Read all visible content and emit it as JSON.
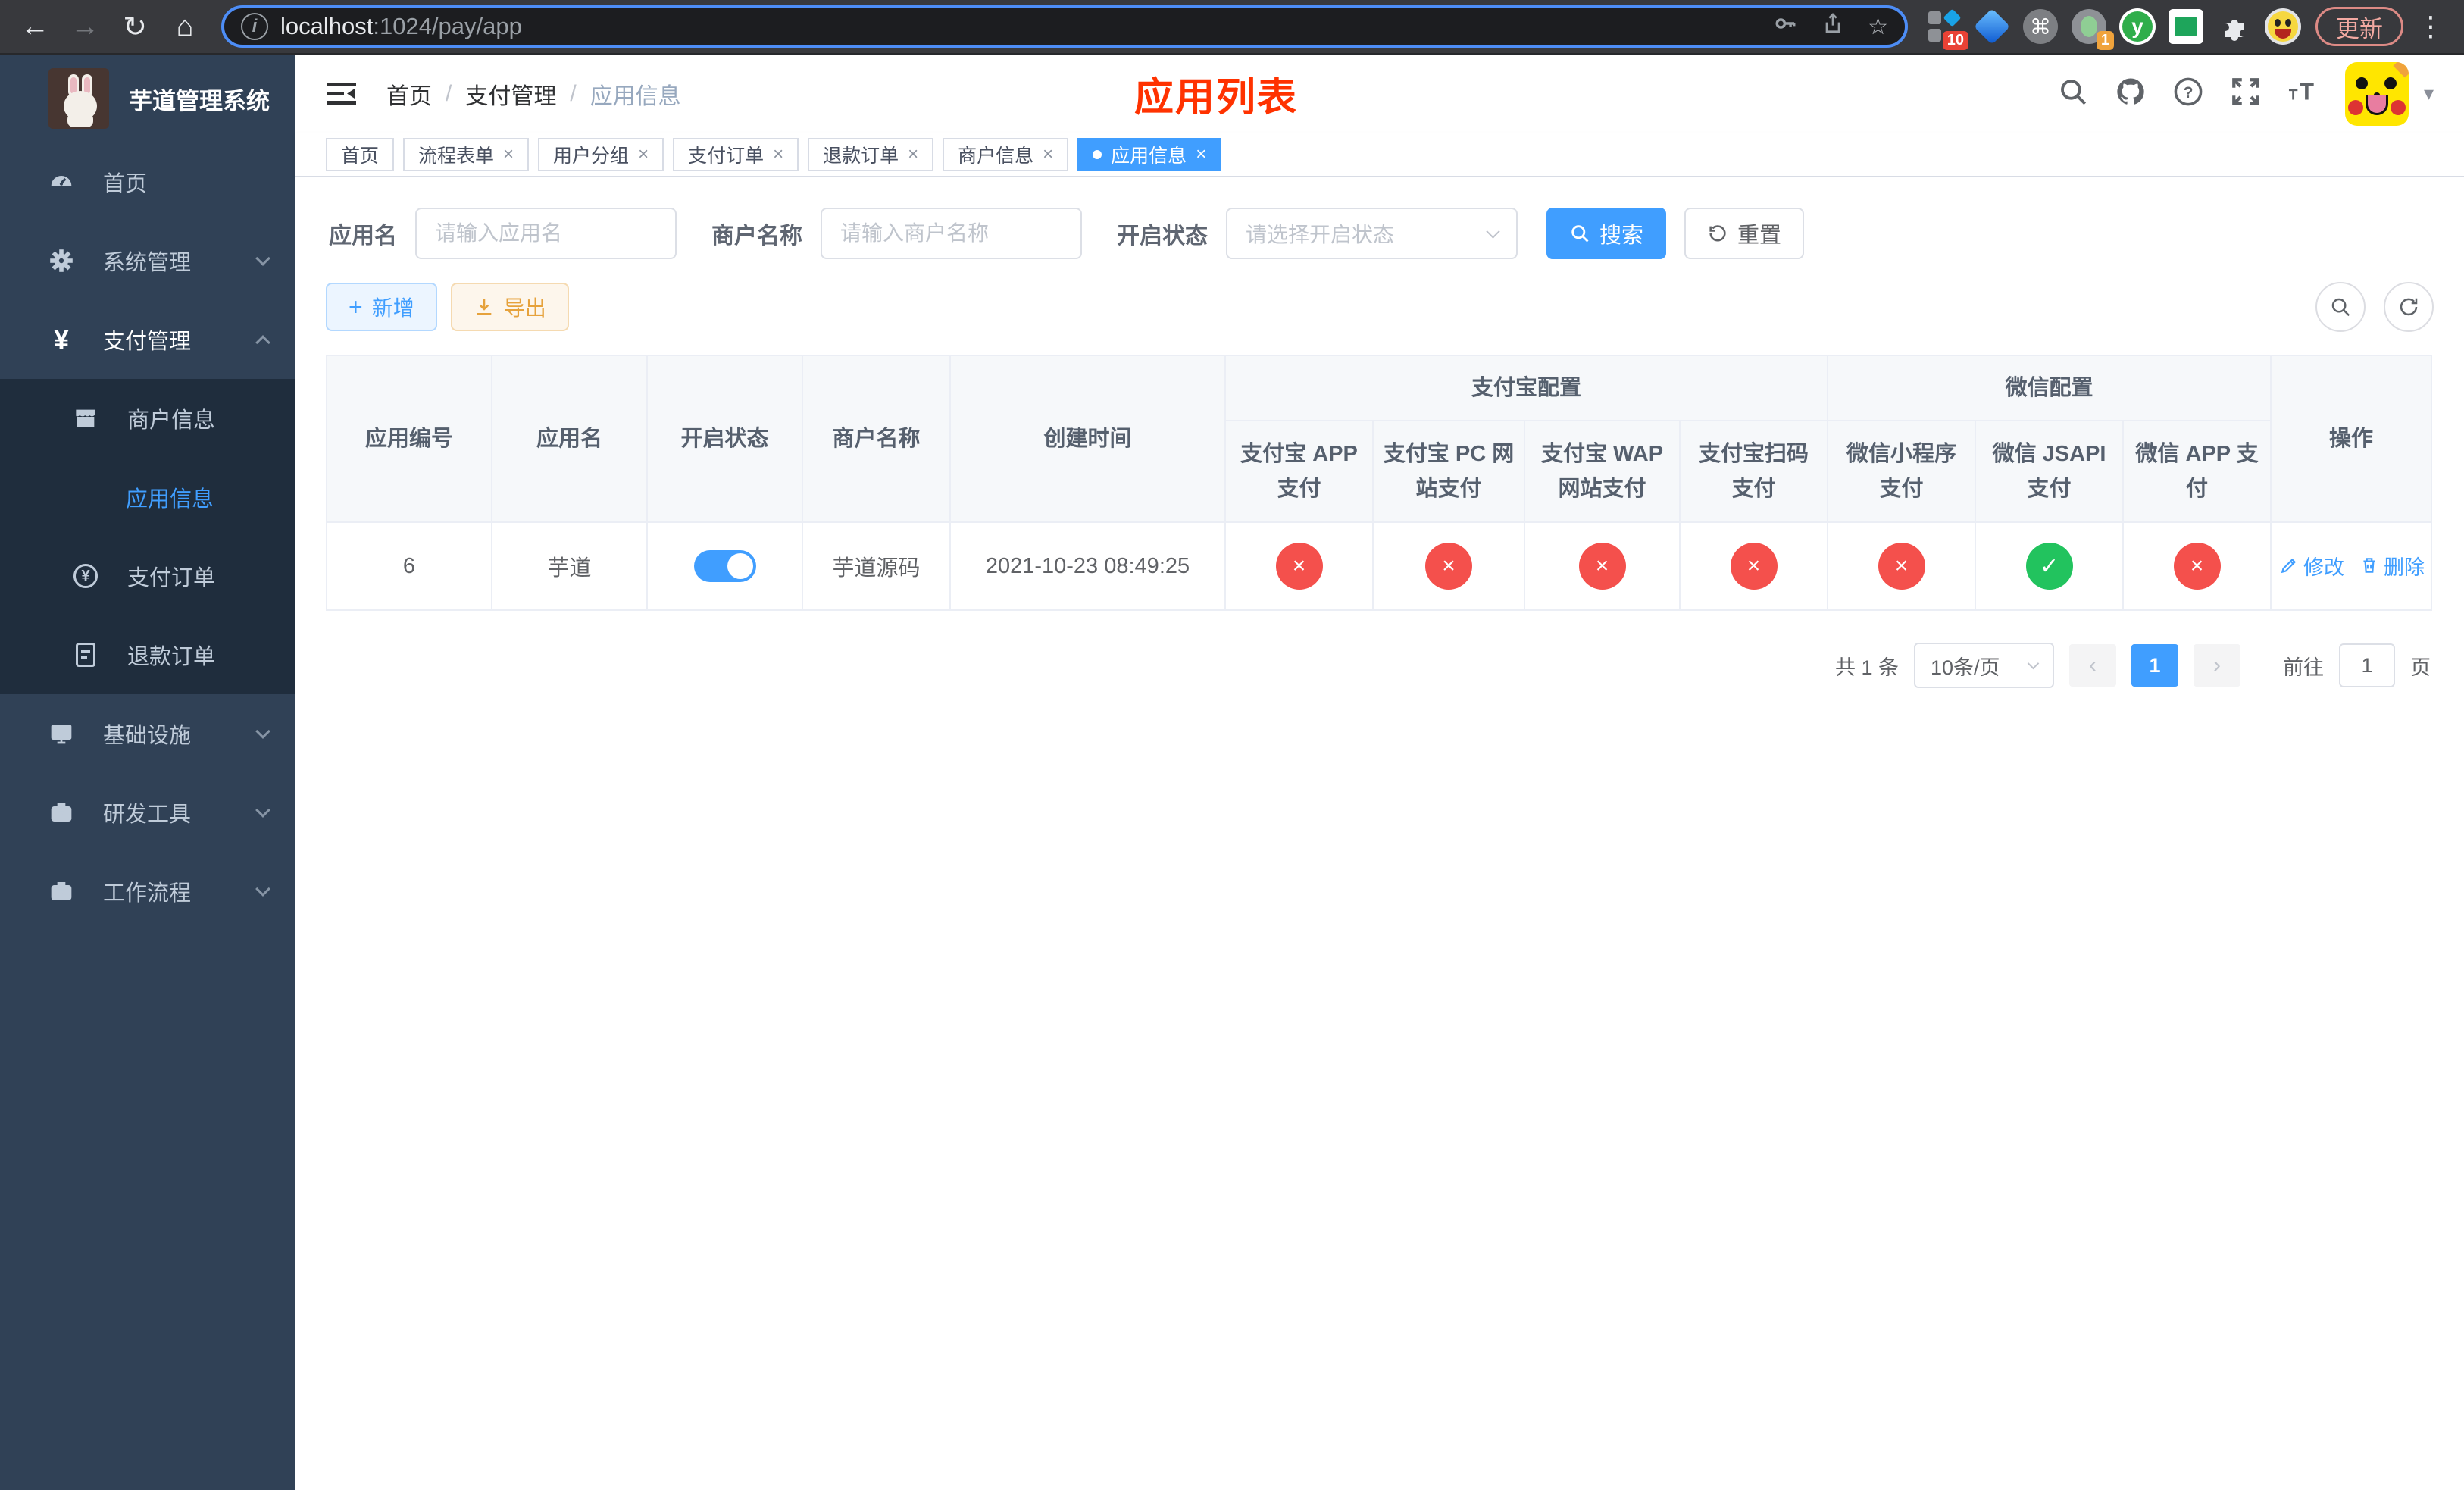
{
  "browser": {
    "host": "localhost",
    "path": ":1024/pay/app",
    "update_label": "更新",
    "ext_badge_grid": "10",
    "ext_badge_profile": "1",
    "ext_y_letter": "y"
  },
  "icons": {
    "back": "←",
    "forward": "→",
    "reload": "↻",
    "home": "⌂",
    "info": "i",
    "star": "☆",
    "menu_dots": "⋮",
    "command": "⌘",
    "caret_down": "▾",
    "close": "×",
    "check": "✓",
    "cross": "×",
    "prev": "‹",
    "next": "›",
    "yen": "¥",
    "plus": "+"
  },
  "sidebar": {
    "title": "芋道管理系统",
    "home": "首页",
    "system": "系统管理",
    "payment": "支付管理",
    "merchant_info": "商户信息",
    "app_info": "应用信息",
    "pay_order": "支付订单",
    "refund_order": "退款订单",
    "infra": "基础设施",
    "devtools": "研发工具",
    "workflow": "工作流程"
  },
  "header": {
    "crumb1": "首页",
    "crumb2": "支付管理",
    "crumb3": "应用信息",
    "separator": "/",
    "page_title": "应用列表"
  },
  "tabs": {
    "t0": "首页",
    "t1": "流程表单",
    "t2": "用户分组",
    "t3": "支付订单",
    "t4": "退款订单",
    "t5": "商户信息",
    "t6": "应用信息"
  },
  "filters": {
    "app_name_label": "应用名",
    "app_name_placeholder": "请输入应用名",
    "merchant_label": "商户名称",
    "merchant_placeholder": "请输入商户名称",
    "status_label": "开启状态",
    "status_placeholder": "请选择开启状态",
    "search_label": "搜索",
    "reset_label": "重置"
  },
  "toolbar": {
    "add_label": "新增",
    "export_label": "导出"
  },
  "table": {
    "headers": {
      "app_id": "应用编号",
      "app_name": "应用名",
      "status": "开启状态",
      "merchant": "商户名称",
      "created": "创建时间",
      "alipay_group": "支付宝配置",
      "wechat_group": "微信配置",
      "alipay_app": "支付宝 APP 支付",
      "alipay_pc": "支付宝 PC 网站支付",
      "alipay_wap": "支付宝 WAP 网站支付",
      "alipay_qr": "支付宝扫码支付",
      "wx_mini": "微信小程序支付",
      "wx_jsapi": "微信 JSAPI 支付",
      "wx_app": "微信 APP 支付",
      "actions": "操作"
    },
    "row": {
      "app_id": "6",
      "app_name": "芋道",
      "status_on": true,
      "merchant": "芋道源码",
      "created": "2021-10-23 08:49:25",
      "alipay_app": "disabled",
      "alipay_pc": "disabled",
      "alipay_wap": "disabled",
      "alipay_qr": "disabled",
      "wx_mini": "disabled",
      "wx_jsapi": "enabled",
      "wx_app": "disabled",
      "edit_label": "修改",
      "delete_label": "删除"
    }
  },
  "pagination": {
    "total": "共 1 条",
    "page_size": "10条/页",
    "page": "1",
    "goto_prefix": "前往",
    "goto_value": "1",
    "goto_suffix": "页"
  },
  "colors": {
    "accent": "#409eff",
    "danger": "#f4504c",
    "success": "#22c35e",
    "warning": "#e6a23c",
    "title_red": "#ff3200",
    "sidebar_bg": "#304156",
    "sidebar_submenu_bg": "#1f2d3d",
    "chrome_bg": "#38393d"
  }
}
